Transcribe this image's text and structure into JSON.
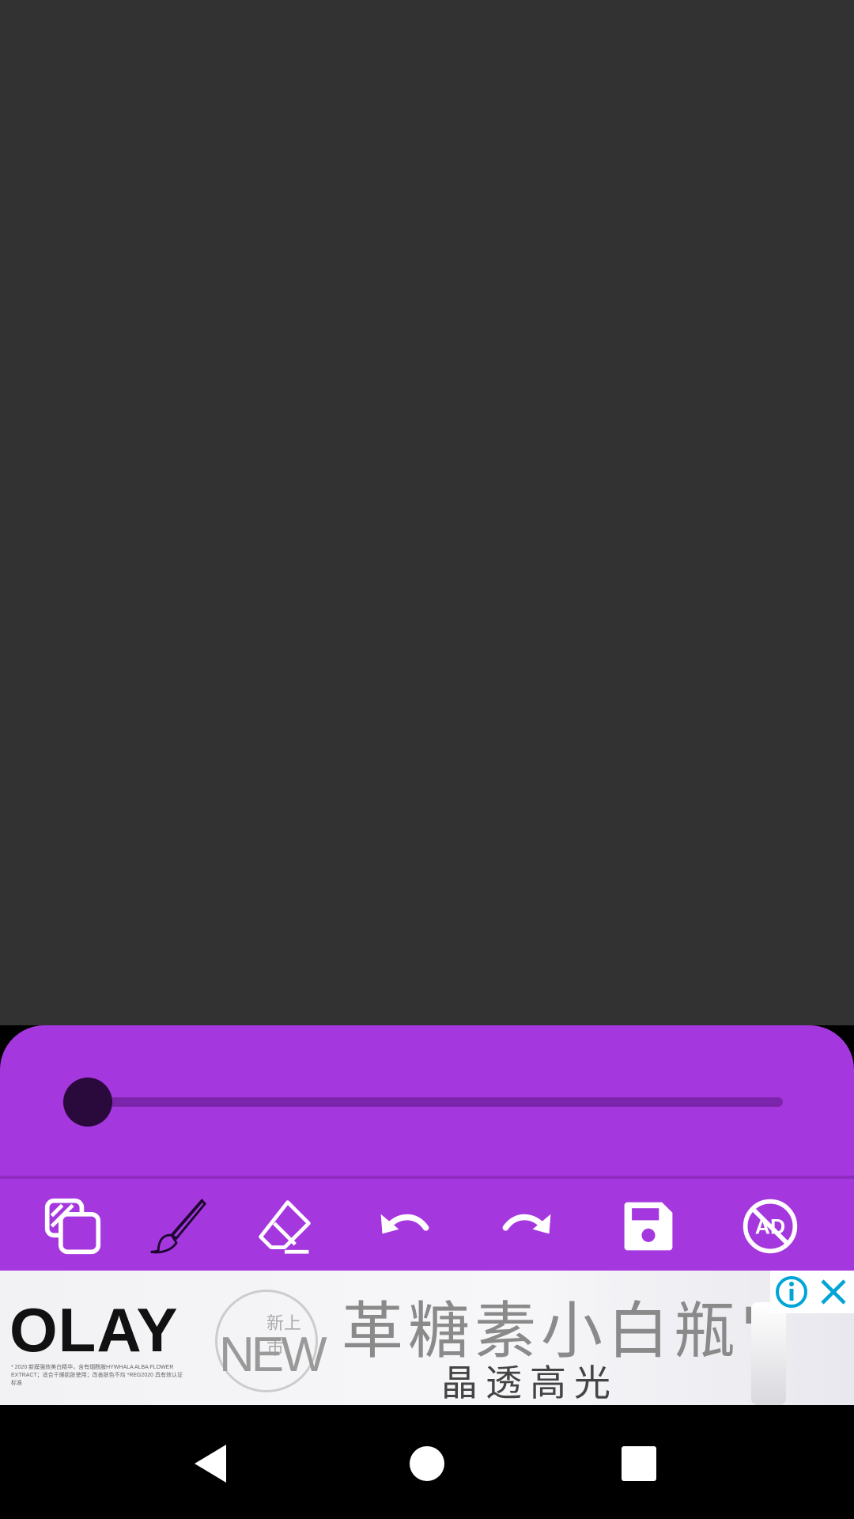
{
  "app": {
    "slider": {
      "label": "brush-size",
      "value_fraction": 0.0
    },
    "toolbar": [
      {
        "name": "layers-tool",
        "icon": "layers-icon"
      },
      {
        "name": "brush-tool",
        "icon": "brush-icon"
      },
      {
        "name": "eraser-tool",
        "icon": "eraser-icon"
      },
      {
        "name": "undo-tool",
        "icon": "undo-icon"
      },
      {
        "name": "redo-tool",
        "icon": "redo-icon"
      },
      {
        "name": "save-tool",
        "icon": "save-icon"
      },
      {
        "name": "remove-ads-tool",
        "icon": "no-ads-icon"
      }
    ],
    "colors": {
      "canvas_bg": "#323232",
      "panel_accent": "#a537de",
      "track": "#7c24ab",
      "thumb": "#2a0a3c"
    }
  },
  "ad": {
    "brand": "OLAY",
    "badge_small": "新上市",
    "badge_big": "NEW",
    "headline": "革糖素小白瓶'",
    "subline": "晶透高光",
    "fineprint": "* 2020 新膜强效美白精华，含有烟酰胺HYWHALA ALBA FLOWER EXTRACT；适合干燥肌肤使用；改善肤色不均 *REG2020 具有效认证标准",
    "controls": {
      "info_icon": "info-icon",
      "close_icon": "close-icon"
    }
  },
  "nav": {
    "back_icon": "back-triangle-icon",
    "home_icon": "home-circle-icon",
    "recents_icon": "recents-square-icon"
  }
}
